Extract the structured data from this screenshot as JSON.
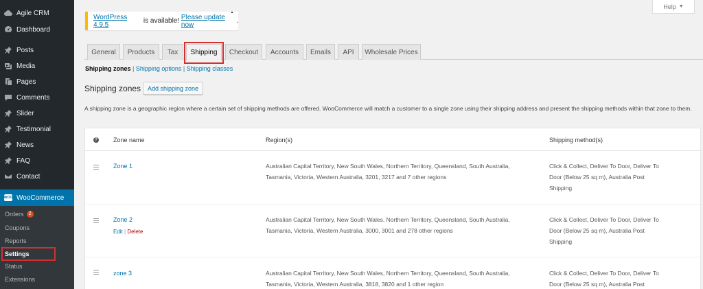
{
  "sidebar": {
    "items": [
      {
        "label": "Agile CRM",
        "icon": "cloud-icon"
      },
      {
        "label": "Dashboard",
        "icon": "gauge-icon"
      },
      {
        "label": "Posts",
        "icon": "pin-icon"
      },
      {
        "label": "Media",
        "icon": "media-icon"
      },
      {
        "label": "Pages",
        "icon": "page-icon"
      },
      {
        "label": "Comments",
        "icon": "comment-icon"
      },
      {
        "label": "Slider",
        "icon": "pin-icon"
      },
      {
        "label": "Testimonial",
        "icon": "pin-icon"
      },
      {
        "label": "News",
        "icon": "pin-icon"
      },
      {
        "label": "FAQ",
        "icon": "pin-icon"
      },
      {
        "label": "Contact",
        "icon": "mail-icon"
      },
      {
        "label": "WooCommerce",
        "icon": "woo-icon",
        "logo_text": "WOO"
      }
    ],
    "submenu": [
      {
        "label": "Orders",
        "badge": "2"
      },
      {
        "label": "Coupons"
      },
      {
        "label": "Reports"
      },
      {
        "label": "Settings"
      },
      {
        "label": "Status"
      },
      {
        "label": "Extensions"
      }
    ]
  },
  "help": {
    "label": "Help",
    "arrow": "▼"
  },
  "notice": {
    "version_link": "WordPress 4.9.5",
    "text": " is available! ",
    "update_link": "Please update now",
    "end": "."
  },
  "tabs": [
    "General",
    "Products",
    "Tax",
    "Shipping",
    "Checkout",
    "Accounts",
    "Emails",
    "API",
    "Wholesale Prices"
  ],
  "active_tab": "Shipping",
  "subnav": {
    "current": "Shipping zones",
    "sep1": " | ",
    "options": "Shipping options",
    "sep2": " | ",
    "classes": "Shipping classes"
  },
  "zones": {
    "title": "Shipping zones",
    "add_button": "Add shipping zone",
    "description": "A shipping zone is a geographic region where a certain set of shipping methods are offered. WooCommerce will match a customer to a single zone using their shipping address and present the shipping methods within that zone to them."
  },
  "table": {
    "help_glyph": "?",
    "headers": {
      "zone": "Zone name",
      "region": "Region(s)",
      "method": "Shipping method(s)"
    },
    "rows": [
      {
        "zone": "Zone 1",
        "region_line1": "Australian Capital Territory, New South Wales, Northern Territory, Queensland, South Australia,",
        "region_line2": "Tasmania, Victoria, Western Australia, 3201, 3217 and 7 other regions",
        "method_line1": "Click & Collect, Deliver To Door, Deliver To",
        "method_line2": "Door (Below 25 sq m), Australia Post",
        "method_line3": "Shipping"
      },
      {
        "zone": "Zone 2",
        "edit": "Edit",
        "sep": " | ",
        "delete": "Delete",
        "region_line1": "Australian Capital Territory, New South Wales, Northern Territory, Queensland, South Australia,",
        "region_line2": "Tasmania, Victoria, Western Australia, 3000, 3001 and 278 other regions",
        "method_line1": "Click & Collect, Deliver To Door, Deliver To",
        "method_line2": "Door (Below 25 sq m), Australia Post",
        "method_line3": "Shipping"
      },
      {
        "zone": "zone 3",
        "region_line1": "Australian Capital Territory, New South Wales, Northern Territory, Queensland, South Australia,",
        "region_line2": "Tasmania, Victoria, Western Australia, 3818, 3820 and 1 other region",
        "method_line1": "Click & Collect, Deliver To Door, Deliver To",
        "method_line2": "Door (Below 25 sq m), Australia Post"
      }
    ]
  },
  "colors": {
    "sidebar_bg": "#23282d",
    "accent": "#0073aa",
    "highlight_box": "#d1302f",
    "notice_border": "#ffba00"
  }
}
